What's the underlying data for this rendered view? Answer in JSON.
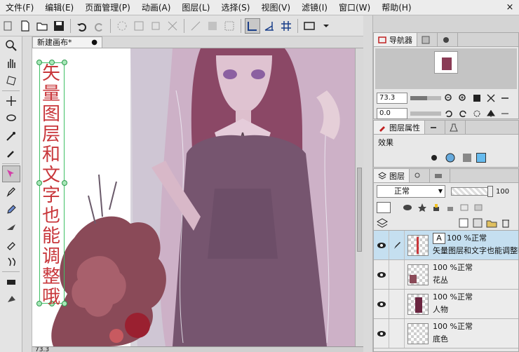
{
  "menu": [
    "文件(F)",
    "编辑(E)",
    "页面管理(P)",
    "动画(A)",
    "图层(L)",
    "选择(S)",
    "视图(V)",
    "滤镜(I)",
    "窗口(W)",
    "帮助(H)"
  ],
  "window_controls": {
    "close": "×"
  },
  "document": {
    "tab_title": "新建画布*",
    "modified_dot": "●"
  },
  "canvas_text": [
    "矢",
    "量",
    "图",
    "层",
    "和",
    "文",
    "字",
    "也",
    "能",
    "调",
    "整",
    "哦"
  ],
  "status": {
    "zoom": "73.3"
  },
  "navigator": {
    "tab_label": "导航器",
    "zoom_value": "73.3",
    "rotation_value": "0.0",
    "zoom_fraction": 0.55,
    "rotation_fraction": 0.0
  },
  "layer_properties": {
    "tab_label": "图层属性",
    "effect_label": "效果",
    "swatch_color": "#66bbee"
  },
  "layers_panel": {
    "tab_label": "图层",
    "blend_mode": "正常",
    "opacity_value": "100",
    "layers": [
      {
        "opacity": "100 %正常",
        "name": "矢量图层和文字也能调整哦",
        "selected": true,
        "type_badge": "A"
      },
      {
        "opacity": "100 %正常",
        "name": "花丛",
        "selected": false,
        "type_badge": ""
      },
      {
        "opacity": "100 %正常",
        "name": "人物",
        "selected": false,
        "type_badge": ""
      },
      {
        "opacity": "100 %正常",
        "name": "底色",
        "selected": false,
        "type_badge": ""
      }
    ]
  },
  "colors": {
    "accent_text": "#c8363a",
    "selection": "#3fbf66",
    "layer_selected": "#c5dff0"
  }
}
